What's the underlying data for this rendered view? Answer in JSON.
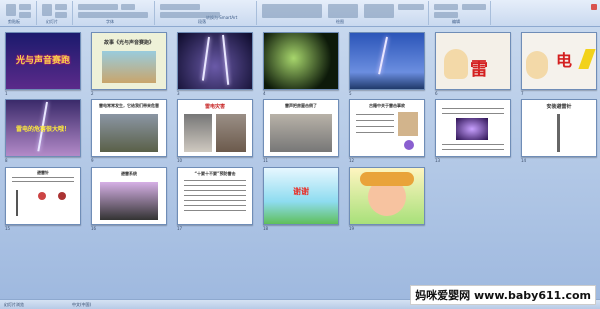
{
  "ribbon": {
    "groups": [
      "剪贴板",
      "幻灯片",
      "字体",
      "段落",
      "绘图",
      "编辑"
    ],
    "smartart_label": "转换为 SmartArt"
  },
  "slides": [
    {
      "num": "1",
      "title": "光与声音赛跑"
    },
    {
      "num": "2",
      "title": "故事《光与声音赛跑》"
    },
    {
      "num": "3",
      "title": ""
    },
    {
      "num": "4",
      "title": ""
    },
    {
      "num": "5",
      "title": ""
    },
    {
      "num": "6",
      "title": "雷"
    },
    {
      "num": "7",
      "title": "电"
    },
    {
      "num": "8",
      "title": "雷电的危害很大哦！"
    },
    {
      "num": "9",
      "title": "雷电常常发生，它给我们带来危害"
    },
    {
      "num": "10",
      "title": "雷电灾害"
    },
    {
      "num": "11",
      "title": "雷声把房屋击倒了"
    },
    {
      "num": "12",
      "title": "古籍中关于雷击事故"
    },
    {
      "num": "13",
      "title": ""
    },
    {
      "num": "14",
      "title": "安装避雷针"
    },
    {
      "num": "15",
      "title": "避雷针"
    },
    {
      "num": "16",
      "title": "避雷系统"
    },
    {
      "num": "17",
      "title": "“十要十不要”预防雷击"
    },
    {
      "num": "18",
      "title": "谢谢"
    },
    {
      "num": "19",
      "title": ""
    }
  ],
  "status": {
    "left": "幻灯片浏览",
    "middle": "中文(中国)"
  },
  "watermark": "妈咪爱婴网 www.baby611.com"
}
